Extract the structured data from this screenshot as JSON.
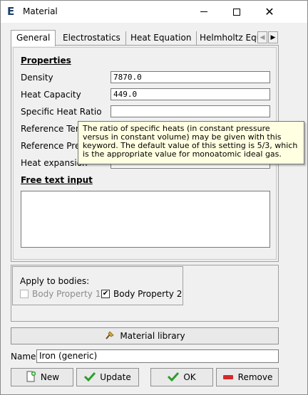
{
  "window": {
    "title": "Material",
    "icon_letter": "E",
    "icon": "elmer-logo-icon",
    "minimize": "minimize-icon",
    "maximize": "maximize-icon",
    "close_glyph": "✕"
  },
  "tabs": [
    {
      "label": "General",
      "active": true
    },
    {
      "label": "Electrostatics",
      "active": false
    },
    {
      "label": "Heat Equation",
      "active": false
    },
    {
      "label": "Helmholtz Equati",
      "active": false
    }
  ],
  "tab_scroll": {
    "left": "◀",
    "right": "▶"
  },
  "properties": {
    "title": "Properties",
    "fields": [
      {
        "label": "Density",
        "value": "7870.0"
      },
      {
        "label": "Heat Capacity",
        "value": "449.0"
      },
      {
        "label": "Specific Heat Ratio",
        "value": ""
      },
      {
        "label": "Reference Tem",
        "value": ""
      },
      {
        "label": "Reference Pres",
        "value": ""
      },
      {
        "label": "Heat expansion",
        "value": ""
      }
    ]
  },
  "free_text": {
    "title": "Free text input",
    "value": ""
  },
  "tooltip": {
    "text": "The ratio of specific heats (in constant pressure versus in constant volume) may be given with this keyword. The default value of this setting is 5/3, which is the appropriate value for monoatomic ideal gas."
  },
  "bodies": {
    "label": "Apply to bodies:",
    "items": [
      {
        "label": "Body Property 1",
        "checked": false,
        "enabled": false
      },
      {
        "label": "Body Property 2",
        "checked": true,
        "enabled": true
      }
    ],
    "check_glyph": "✔"
  },
  "library_button": {
    "label": "Material library",
    "icon": "broom-icon"
  },
  "name": {
    "label": "Name:",
    "value": "Iron (generic)"
  },
  "buttons": {
    "new": {
      "label": "New",
      "icon": "new-document-icon"
    },
    "update": {
      "label": "Update",
      "icon": "check-icon"
    },
    "ok": {
      "label": "OK",
      "icon": "check-icon"
    },
    "remove": {
      "label": "Remove",
      "icon": "minus-icon"
    }
  },
  "colors": {
    "check_green": "#2e9d2e",
    "remove_red": "#d42a2a",
    "tooltip_bg": "#ffffe1"
  }
}
